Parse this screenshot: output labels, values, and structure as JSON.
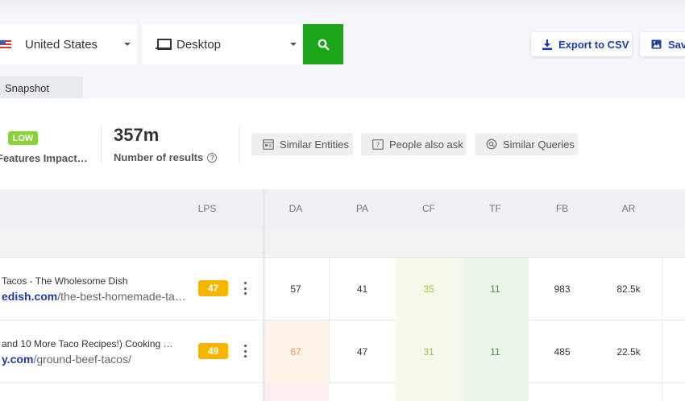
{
  "filters": {
    "country": "United States",
    "device": "Desktop"
  },
  "actions": {
    "export_label": "Export to CSV",
    "save_label": "Save"
  },
  "tabs": {
    "snapshot_label": "Snapshot"
  },
  "summary": {
    "serp_badge": "LOW",
    "serp_label": "Features Impact…",
    "results_value": "357m",
    "results_label": "Number of results",
    "help_symbol": "?"
  },
  "chips": [
    {
      "label": "Similar Entities",
      "icon": "entity-icon"
    },
    {
      "label": "People also ask",
      "icon": "question-icon"
    },
    {
      "label": "Similar Queries",
      "icon": "query-icon"
    }
  ],
  "table": {
    "columns": [
      "LPS",
      "DA",
      "PA",
      "CF",
      "TF",
      "FB",
      "AR"
    ],
    "rows": [
      {
        "title": "Tacos - The Wholesome Dish",
        "url_domain": "edish.com",
        "url_path": "/the-best-homemade-ta…",
        "lps": "47",
        "da": "57",
        "pa": "41",
        "cf": "35",
        "tf": "11",
        "fb": "983",
        "ar": "82.5k"
      },
      {
        "title": "and 10 More Taco Recipes!) Cooking …",
        "url_domain": "y.com",
        "url_path": "/ground-beef-tacos/",
        "lps": "49",
        "da": "67",
        "pa": "47",
        "cf": "31",
        "tf": "11",
        "fb": "485",
        "ar": "22.5k"
      }
    ]
  },
  "colors": {
    "search_green": "#1ba619",
    "brand_blue": "#1d3ba8",
    "low_badge": "#8bd13a",
    "lps_badge": "#f5b400",
    "cf_text": "#9cc43c",
    "cf_bg": "#f5f9ea",
    "tf_text": "#2e9e3e",
    "tf_bg": "#e9f5e8",
    "da_orange_text": "#e89a4c",
    "da_orange_bg": "#fdf3e9"
  }
}
